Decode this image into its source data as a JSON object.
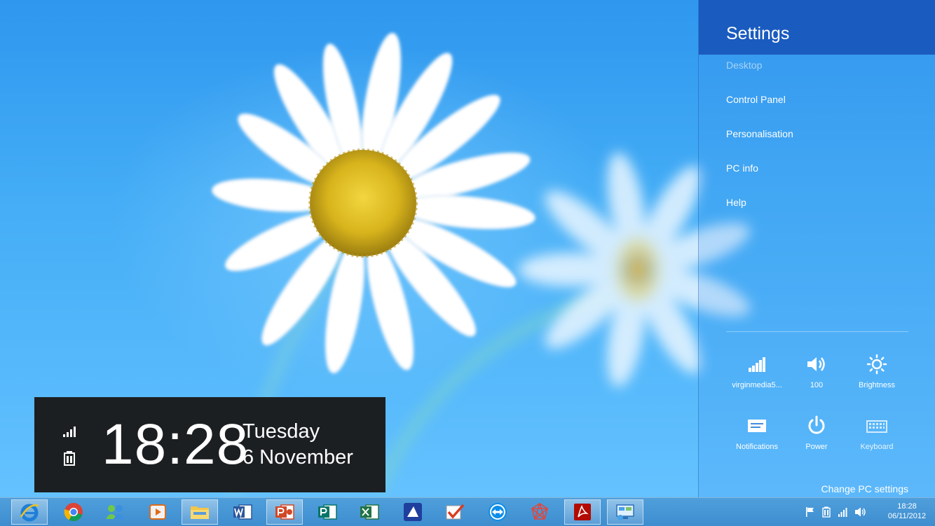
{
  "clock": {
    "time": "18:28",
    "day": "Tuesday",
    "date": "6 November"
  },
  "settings": {
    "title": "Settings",
    "menu": [
      "Desktop",
      "Control Panel",
      "Personalisation",
      "PC info",
      "Help"
    ],
    "quick_settings": {
      "network": "virginmedia5...",
      "volume": "100",
      "brightness": "Brightness",
      "notifications": "Notifications",
      "power": "Power",
      "keyboard": "Keyboard"
    },
    "change_pc_settings": "Change PC settings"
  },
  "taskbar": {
    "apps": [
      "internet-explorer",
      "chrome",
      "messenger",
      "media-player",
      "file-explorer",
      "word",
      "powerpoint",
      "publisher",
      "excel",
      "app-blue",
      "todo-check",
      "teamviewer",
      "network-app",
      "acrobat",
      "remote-desktop"
    ],
    "active_apps": [
      "internet-explorer",
      "file-explorer",
      "powerpoint",
      "acrobat",
      "remote-desktop"
    ],
    "tray_time": "18:28",
    "tray_date": "06/11/2012"
  },
  "colors": {
    "settings_header": "#1a5bbf",
    "clock_panel": "#1c1f22",
    "taskbar": "#4596d5"
  }
}
